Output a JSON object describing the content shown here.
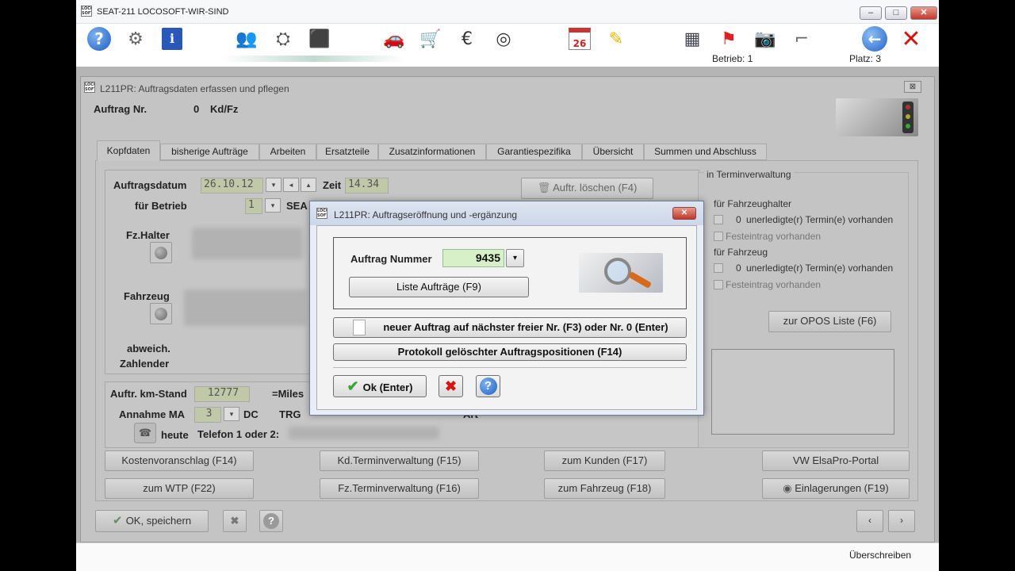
{
  "window": {
    "title": "SEAT-211 LOCOSOFT-WIR-SIND",
    "logo_text": "LOCO SOFT"
  },
  "toolbar": {
    "betrieb": "Betrieb: 1",
    "platz": "Platz:  3",
    "calendar_day": "26"
  },
  "child": {
    "title": "L211PR: Auftragsdaten erfassen und pflegen",
    "close": "⊠"
  },
  "header": {
    "auftrag_label": "Auftrag Nr.",
    "auftrag_value": "0",
    "kdfz": "Kd/Fz"
  },
  "tabs": [
    "Kopfdaten",
    "bisherige Aufträge",
    "Arbeiten",
    "Ersatzteile",
    "Zusatzinformationen",
    "Garantiespezifika",
    "Übersicht",
    "Summen und Abschluss"
  ],
  "form": {
    "auftragsdatum_label": "Auftragsdatum",
    "auftragsdatum": "26.10.12",
    "zeit_label": "Zeit",
    "zeit": "14.34",
    "fuer_betrieb_label": "für Betrieb",
    "betrieb_value": "1",
    "betrieb_name": "SEA",
    "auftr_loeschen": "Auftr. löschen (F4)",
    "fz_halter": "Fz.Halter",
    "fahrzeug": "Fahrzeug",
    "abweich": "abweich.",
    "zahlender": "Zahlender",
    "km_label": "Auftr. km-Stand",
    "km_value": "12777",
    "miles": "=Miles",
    "annahme_label": "Annahme MA",
    "annahme_value": "3",
    "annahme_suffix": "DC",
    "trg": "TRG",
    "art": "Art",
    "heute": "heute",
    "telefon": "Telefon 1 oder 2:"
  },
  "termin": {
    "title": "in Terminverwaltung",
    "halter_label": "für Fahrzeughalter",
    "halter_count": "0",
    "halter_text": "unerledigte(r) Termin(e) vorhanden",
    "halter_fest": "Festeintrag vorhanden",
    "fz_label": "für Fahrzeug",
    "fz_count": "0",
    "fz_text": "unerledigte(r) Termin(e) vorhanden",
    "fz_fest": "Festeintrag vorhanden",
    "opos": "zur OPOS Liste (F6)"
  },
  "buttons": {
    "kostenvoranschlag": "Kostenvoranschlag (F14)",
    "kd_termin": "Kd.Terminverwaltung (F15)",
    "zum_kunden": "zum Kunden (F17)",
    "elsapro": "VW ElsaPro-Portal",
    "zum_wtp": "zum WTP (F22)",
    "fz_termin": "Fz.Terminverwaltung (F16)",
    "zum_fahrzeug": "zum Fahrzeug (F18)",
    "einlagerungen": "Einlagerungen (F19)",
    "ok_speichern": "OK, speichern",
    "prev": "‹",
    "next": "›"
  },
  "dialog": {
    "title": "L211PR: Auftragseröffnung und -ergänzung",
    "auftrag_nummer_label": "Auftrag Nummer",
    "auftrag_nummer": "9435",
    "liste": "Liste Aufträge (F9)",
    "neuer_auftrag": "neuer Auftrag auf nächster freier Nr. (F3) oder Nr. 0 (Enter)",
    "protokoll": "Protokoll gelöschter Auftragspositionen (F14)",
    "ok": "Ok (Enter)"
  },
  "status": {
    "mode": "Überschreiben"
  },
  "colors": {
    "accent": "#2a4cc8",
    "danger": "#cc1010",
    "date_field": "#c0c8a8",
    "amount_field": "#d8f0c8"
  }
}
